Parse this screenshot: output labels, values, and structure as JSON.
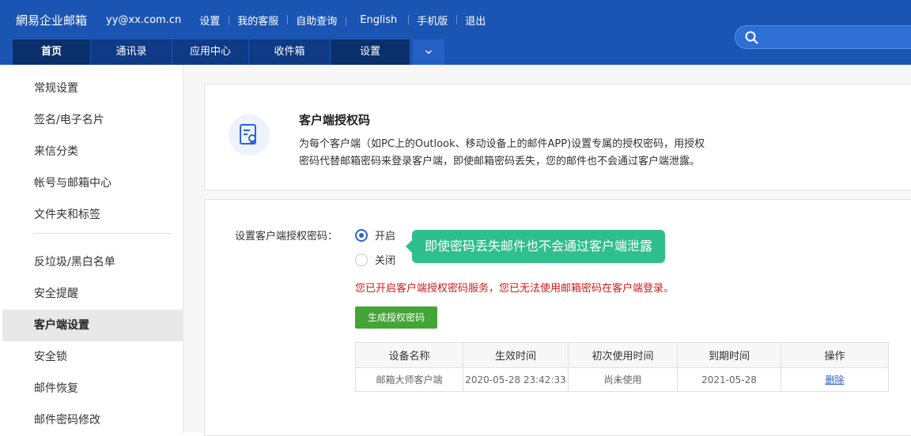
{
  "header": {
    "logo": "網易企业邮箱",
    "user_email": "yy@xx.com.cn",
    "links": [
      "设置",
      "我的客服",
      "自助查询",
      "English",
      "手机版",
      "退出"
    ],
    "tabs": [
      "首页",
      "通讯录",
      "应用中心",
      "收件箱",
      "设置"
    ],
    "more_icon": "chevron-down-icon",
    "search_icon": "search-icon"
  },
  "sidebar": {
    "items": [
      "常规设置",
      "签名/电子名片",
      "来信分类",
      "帐号与邮箱中心",
      "文件夹和标签",
      "反垃圾/黑白名单",
      "安全提醒",
      "客户端设置",
      "安全锁",
      "邮件恢复",
      "邮件密码修改"
    ],
    "active": "客户端设置"
  },
  "info": {
    "title": "客户端授权码",
    "desc_line1": "为每个客户端（如PC上的Outlook、移动设备上的邮件APP)设置专属的授权密码，用授权",
    "desc_line2": "密码代替邮箱密码来登录客户端，即使邮箱密码丢失，您的邮件也不会通过客户端泄露。"
  },
  "settings": {
    "label": "设置客户端授权密码：",
    "option_on": "开启",
    "option_off": "关闭",
    "selected": "开启",
    "tooltip": "即使密码丢失邮件也不会通过客户端泄露",
    "warning": "您已开启客户端授权密码服务，您已无法使用邮箱密码在客户端登录。",
    "generate_button": "生成授权密码",
    "table": {
      "headers": [
        "设备名称",
        "生效时间",
        "初次使用时间",
        "到期时间",
        "操作"
      ],
      "rows": [
        [
          "邮箱大师客户端",
          "2020-05-28 23:42:33",
          "尚未使用",
          "2021-05-28",
          "删除"
        ]
      ]
    }
  },
  "colors": {
    "header_bg": "#1b55b3",
    "tooltip_bg": "#2fbf8f",
    "button_green": "#43a536",
    "warning_red": "#d41a1a",
    "radio_blue": "#2a64d6"
  }
}
